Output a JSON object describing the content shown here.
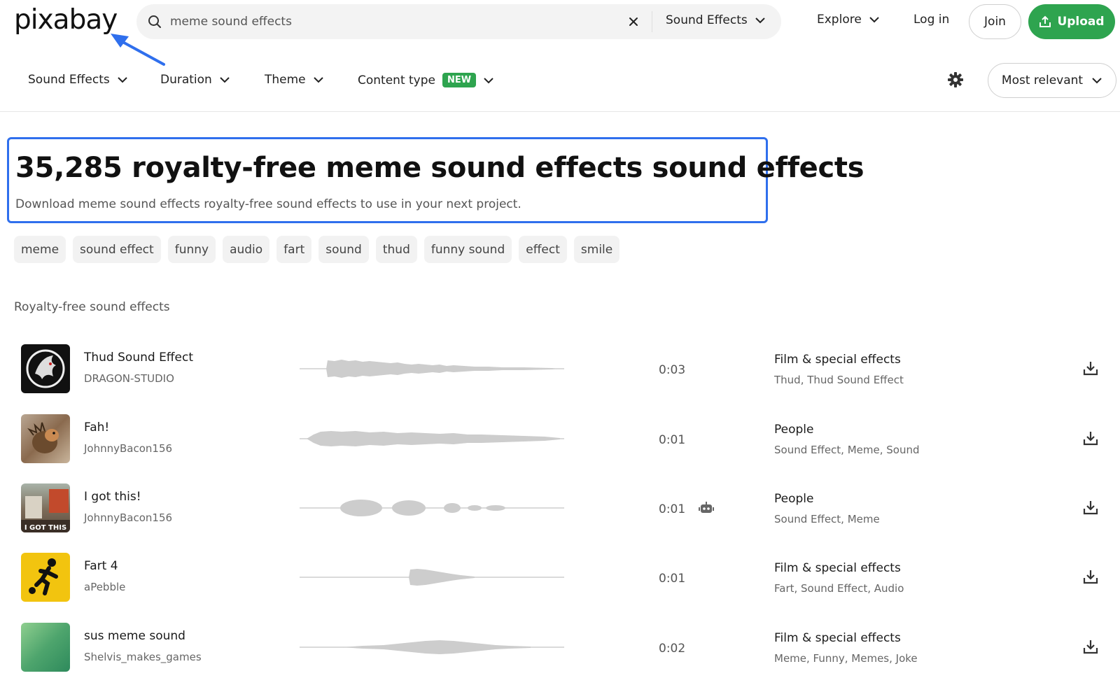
{
  "header": {
    "logo_text": "pixabay",
    "search": {
      "value": "meme sound effects",
      "placeholder": "meme sound effects"
    },
    "search_type_label": "Sound Effects",
    "explore_label": "Explore",
    "login_label": "Log in",
    "join_label": "Join",
    "upload_label": "Upload"
  },
  "filters": {
    "items": [
      {
        "label": "Sound Effects"
      },
      {
        "label": "Duration"
      },
      {
        "label": "Theme"
      },
      {
        "label": "Content type",
        "badge": "NEW"
      }
    ],
    "sort_label": "Most relevant"
  },
  "heading": {
    "title": "35,285 royalty-free meme sound effects sound effects",
    "subtitle": "Download meme sound effects royalty-free sound effects to use in your next project."
  },
  "tags": [
    "meme",
    "sound effect",
    "funny",
    "audio",
    "fart",
    "sound",
    "thud",
    "funny sound",
    "effect",
    "smile"
  ],
  "section_label": "Royalty-free sound effects",
  "tracks": [
    {
      "title": "Thud Sound Effect",
      "artist": "DRAGON-STUDIO",
      "duration": "0:03",
      "category": "Film & special effects",
      "tags": "Thud, Thud Sound Effect",
      "ai": false,
      "thumb_icon": "dragon-logo-icon"
    },
    {
      "title": "Fah!",
      "artist": "JohnnyBacon156",
      "duration": "0:01",
      "category": "People",
      "tags": "Sound Effect, Meme, Sound",
      "ai": false,
      "thumb_icon": "hedgehog-photo"
    },
    {
      "title": "I got this!",
      "artist": "JohnnyBacon156",
      "duration": "0:01",
      "category": "People",
      "tags": "Sound Effect, Meme",
      "ai": true,
      "thumb_icon": "meme-photo",
      "thumb_text": "I GOT THIS"
    },
    {
      "title": "Fart 4",
      "artist": "aPebble",
      "duration": "0:01",
      "category": "Film & special effects",
      "tags": "Fart, Sound Effect, Audio",
      "ai": false,
      "thumb_icon": "running-figure-icon"
    },
    {
      "title": "sus meme sound",
      "artist": "Shelvis_makes_games",
      "duration": "0:02",
      "category": "Film & special effects",
      "tags": "Meme, Funny, Memes, Joke",
      "ai": false,
      "thumb_icon": "green-gradient"
    }
  ],
  "colors": {
    "accent_green": "#2ea44f",
    "highlight_blue": "#2f6fed",
    "waveform_gray": "#cdcdcd"
  }
}
